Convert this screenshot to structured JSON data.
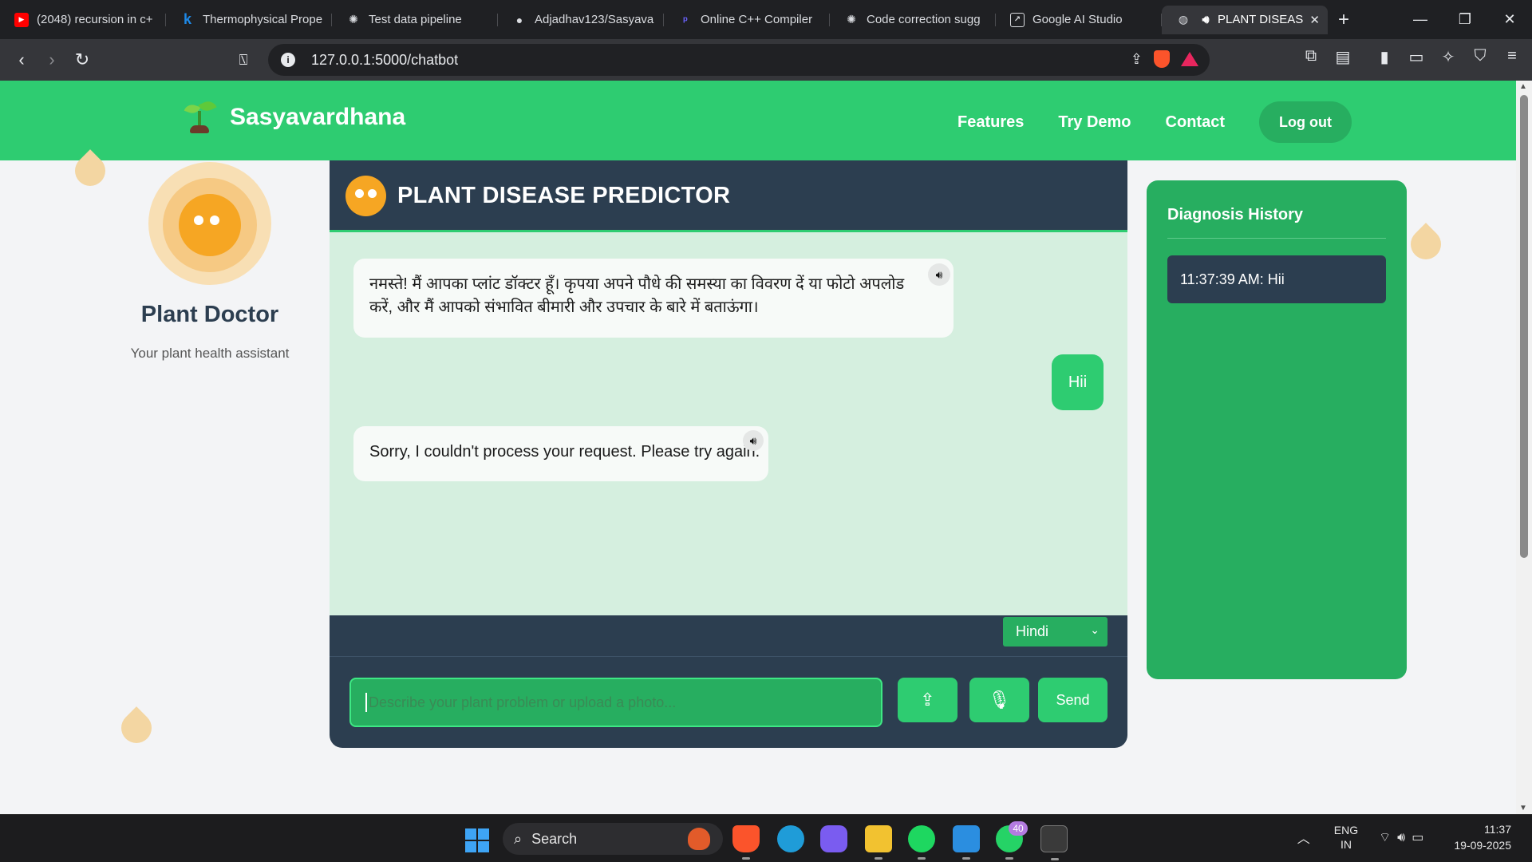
{
  "browser": {
    "tabs": [
      {
        "title": "(2048) recursion in c+",
        "icon": "youtube-icon",
        "color": "#ff0000"
      },
      {
        "title": "Thermophysical Prope",
        "icon": "k-icon",
        "color": "#1e88e5"
      },
      {
        "title": "Test data pipeline",
        "icon": "openai-icon",
        "color": "#dadce0"
      },
      {
        "title": "Adjadhav123/Sasyava",
        "icon": "github-icon",
        "color": "#dadce0"
      },
      {
        "title": "Online C++ Compiler",
        "icon": "programiz-icon",
        "color": "#6c63ff"
      },
      {
        "title": "Code correction sugg",
        "icon": "openai-icon",
        "color": "#dadce0"
      },
      {
        "title": "Google AI Studio",
        "icon": "aistudio-icon",
        "color": "#dadce0"
      },
      {
        "title": "PLANT DISEAS",
        "icon": "speaker-icon",
        "color": "#dadce0"
      }
    ],
    "url": "127.0.0.1:5000/chatbot"
  },
  "navbar": {
    "brand": "Sasyavardhana",
    "links": [
      "Features",
      "Try Demo",
      "Contact"
    ],
    "logout": "Log out"
  },
  "profile": {
    "title": "Plant Doctor",
    "subtitle": "Your plant health assistant"
  },
  "chat": {
    "title": "PLANT DISEASE PREDICTOR",
    "messages": [
      {
        "role": "bot",
        "text": "नमस्ते! मैं आपका प्लांट डॉक्टर हूँ। कृपया अपने पौधे की समस्या का विवरण दें या फोटो अपलोड करें, और मैं आपको संभावित बीमारी और उपचार के बारे में बताऊंगा।"
      },
      {
        "role": "user",
        "text": "Hii"
      },
      {
        "role": "bot",
        "text": "Sorry, I couldn't process your request. Please try again."
      }
    ],
    "language": "Hindi",
    "input_placeholder": "Describe your plant problem or upload a photo...",
    "send": "Send"
  },
  "history": {
    "title": "Diagnosis History",
    "items": [
      "11:37:39 AM: Hii"
    ]
  },
  "taskbar": {
    "search": "Search",
    "whatsapp_badge": "40",
    "lang_line1": "ENG",
    "lang_line2": "IN",
    "time": "11:37",
    "date": "19-09-2025"
  },
  "colors": {
    "primary_green": "#2ecc71",
    "dark_green": "#27ae60",
    "navy": "#2c3e50",
    "chat_bg": "#d5efdf",
    "accent_orange": "#f6a623"
  }
}
